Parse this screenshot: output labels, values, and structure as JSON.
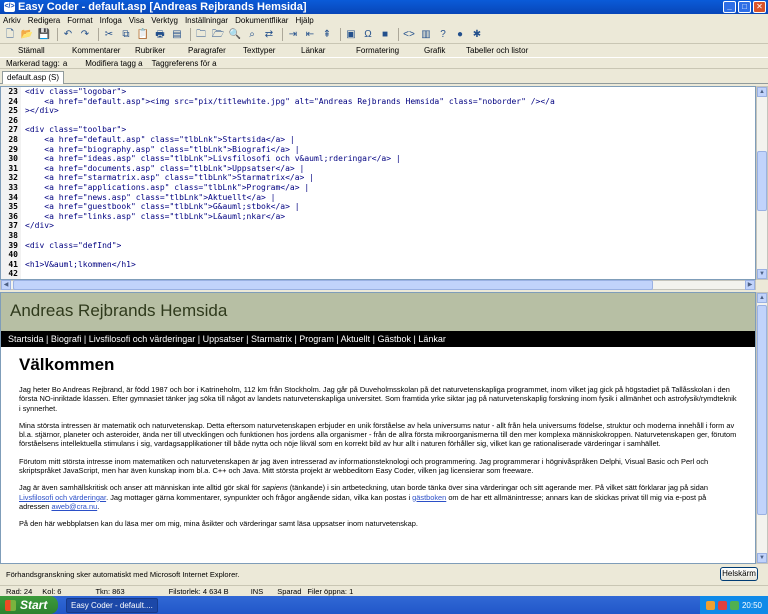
{
  "window": {
    "title": "Easy Coder - default.asp [Andreas Rejbrands Hemsida]",
    "minimize": "_",
    "maximize": "□",
    "close": "✕"
  },
  "menu": [
    "Arkiv",
    "Redigera",
    "Format",
    "Infoga",
    "Visa",
    "Verktyg",
    "Inställningar",
    "Dokumentflikar",
    "Hjälp"
  ],
  "category_tabs": [
    "Stämall",
    "Kommentarer",
    "Rubriker",
    "Paragrafer",
    "Texttyper",
    "Länkar",
    "Formatering",
    "Grafik",
    "Tabeller och listor"
  ],
  "tag_row": {
    "marked_label": "Markerad tagg:",
    "marked_value": "a",
    "modify": "Modifiera tagg a",
    "tagref": "Taggreferens för a"
  },
  "file_tab": "default.asp (S)",
  "code_lines": [
    {
      "n": "23",
      "t": "<div class=\"logobar\">"
    },
    {
      "n": "24",
      "t": "    <a href=\"default.asp\"><img src=\"pix/titlewhite.jpg\" alt=\"Andreas Rejbrands Hemsida\" class=\"noborder\" /></a"
    },
    {
      "n": "25",
      "t": "></div>"
    },
    {
      "n": "26",
      "t": ""
    },
    {
      "n": "27",
      "t": "<div class=\"toolbar\">"
    },
    {
      "n": "28",
      "t": "    <a href=\"default.asp\" class=\"tlbLnk\">Startsida</a> |"
    },
    {
      "n": "29",
      "t": "    <a href=\"biography.asp\" class=\"tlbLnk\">Biografi</a> |"
    },
    {
      "n": "30",
      "t": "    <a href=\"ideas.asp\" class=\"tlbLnk\">Livsfilosofi och v&auml;rderingar</a> |"
    },
    {
      "n": "31",
      "t": "    <a href=\"documents.asp\" class=\"tlbLnk\">Uppsatser</a> |"
    },
    {
      "n": "32",
      "t": "    <a href=\"starmatrix.asp\" class=\"tlbLnk\">Starmatrix</a> |"
    },
    {
      "n": "33",
      "t": "    <a href=\"applications.asp\" class=\"tlbLnk\">Program</a> |"
    },
    {
      "n": "34",
      "t": "    <a href=\"news.asp\" class=\"tlbLnk\">Aktuellt</a> |"
    },
    {
      "n": "35",
      "t": "    <a href=\"guestbook\" class=\"tlbLnk\">G&auml;stbok</a> |"
    },
    {
      "n": "36",
      "t": "    <a href=\"links.asp\" class=\"tlbLnk\">L&auml;nkar</a>"
    },
    {
      "n": "37",
      "t": "</div>"
    },
    {
      "n": "38",
      "t": ""
    },
    {
      "n": "39",
      "t": "<div class=\"defInd\">"
    },
    {
      "n": "40",
      "t": ""
    },
    {
      "n": "41",
      "t": "<h1>V&auml;lkommen</h1>"
    },
    {
      "n": "42",
      "t": ""
    }
  ],
  "preview": {
    "site_title": "Andreas Rejbrands Hemsida",
    "nav": "Startsida  |  Biografi  |  Livsfilosofi och värderingar  |  Uppsatser  |  Starmatrix  |  Program  |  Aktuellt  |  Gästbok  |  Länkar",
    "heading": "Välkommen",
    "p1": "Jag heter Bo Andreas Rejbrand, är född 1987 och bor i Katrineholm, 112 km från Stockholm. Jag går på Duveholmsskolan på det naturvetenskapliga programmet, inom vilket jag gick på högstadiet på Tallåsskolan i den första NO-inriktade klassen. Efter gymnasiet tänker jag söka till något av landets naturvetenskapliga universitet. Som framtida yrke siktar jag på naturvetenskaplig forskning inom fysik i allmänhet och astrofysik/rymdteknik i synnerhet.",
    "p2": "Mina största intressen är matematik och naturvetenskap. Detta eftersom naturvetenskapen erbjuder en unik förståelse av hela universums natur - allt från hela universums födelse, struktur och moderna innehåll i form av bl.a. stjärnor, planeter och asteroider, ända ner till utvecklingen och funktionen hos jordens alla organismer - från de allra första mikroorganismerna till den mer komplexa människokroppen. Naturvetenskapen ger, förutom förståelsens intellektuella stimulans i sig, vardagsapplikationer till både nytta och nöje likväl som en korrekt bild av hur allt i naturen förhåller sig, vilket kan ge rationaliserade värderingar i samhället.",
    "p3": "Förutom mitt största intresse inom matematiken och naturvetenskapen är jag även intresserad av informationsteknologi och programmering. Jag programmerar i högnivåspråken Delphi, Visual Basic och Perl och skriptspråket JavaScript, men har även kunskap inom bl.a. C++ och Java. Mitt största projekt är webbeditorn Easy Coder, vilken jag licensierar som freeware.",
    "p4a": "Jag är även samhällskritisk och anser att människan inte alltid gör skäl för ",
    "p4_em": "sapiens",
    "p4b": " (tänkande) i sin artbeteckning, utan borde tänka över sina värderingar och sitt agerande mer. På vilket sätt förklarar jag på sidan ",
    "p4_link1": "Livsfilosofi och värderingar",
    "p4c": ". Jag mottager gärna kommentarer, synpunkter och frågor angående sidan, vilka kan postas i ",
    "p4_link2": "gästboken",
    "p4d": " om de har ett allmänintresse; annars kan de skickas privat till mig via e-post på adressen ",
    "p4_link3": "aweb@cra.nu",
    "p4e": ".",
    "p5": "På den här webbplatsen kan du läsa mer om mig, mina åsikter och värderingar samt läsa uppsatser inom naturvetenskap."
  },
  "preview_note": "Förhandsgranskning sker automatiskt med Microsoft Internet Explorer.",
  "fullscreen_button": "Helskärm",
  "status": {
    "row": "Rad: 24",
    "col": "Kol: 6",
    "chars": "Tkn: 863",
    "filesize": "Filstorlek: 4 634 B",
    "ins": "INS",
    "saved": "Sparad",
    "files_open": "Filer öppna: 1"
  },
  "taskbar": {
    "start": "Start",
    "task": "Easy Coder - default....",
    "clock": "20:50"
  }
}
